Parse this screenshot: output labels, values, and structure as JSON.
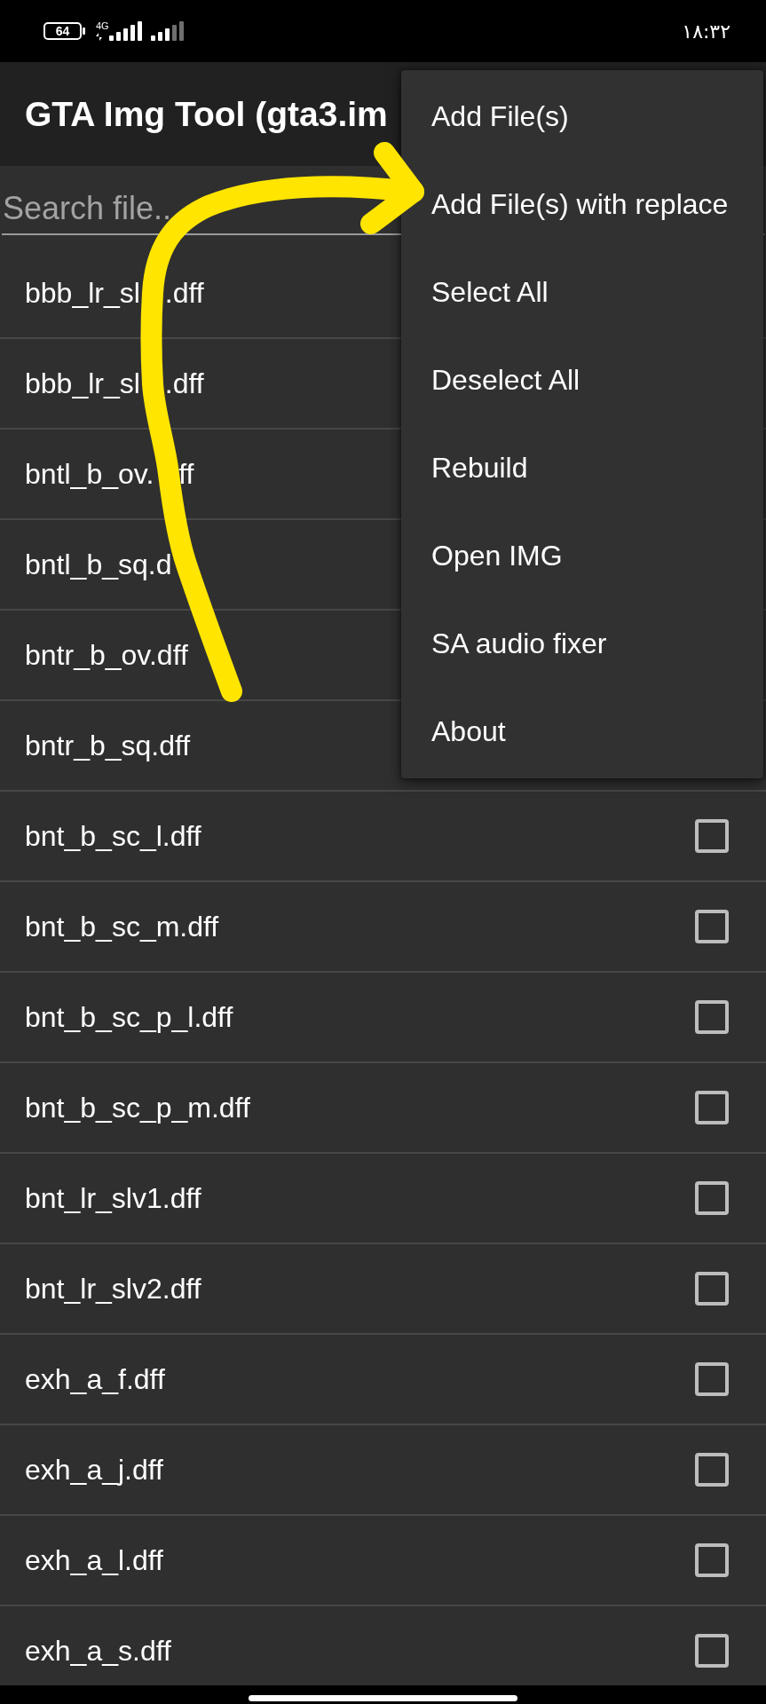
{
  "status_bar": {
    "battery": "64",
    "network_type": "4G",
    "time": "۱۸:۳۲"
  },
  "app_bar": {
    "title": "GTA Img Tool (gta3.im"
  },
  "search": {
    "placeholder": "Search file.."
  },
  "files": [
    {
      "name_fragments": [
        "bbb_lr_sl",
        ".dff"
      ]
    },
    {
      "name_fragments": [
        "bbb_lr_sl",
        ".dff"
      ]
    },
    {
      "name_fragments": [
        "bntl_b_ov.",
        "ff"
      ]
    },
    {
      "name_fragments": [
        "bntl_b_sq.d"
      ]
    },
    {
      "name": "bntr_b_ov.dff"
    },
    {
      "name": "bntr_b_sq.dff"
    },
    {
      "name": "bnt_b_sc_l.dff",
      "checked": false
    },
    {
      "name": "bnt_b_sc_m.dff",
      "checked": false
    },
    {
      "name": "bnt_b_sc_p_l.dff",
      "checked": false
    },
    {
      "name": "bnt_b_sc_p_m.dff",
      "checked": false
    },
    {
      "name": "bnt_lr_slv1.dff",
      "checked": false
    },
    {
      "name": "bnt_lr_slv2.dff",
      "checked": false
    },
    {
      "name": "exh_a_f.dff",
      "checked": false
    },
    {
      "name": "exh_a_j.dff",
      "checked": false
    },
    {
      "name": "exh_a_l.dff",
      "checked": false
    },
    {
      "name": "exh_a_s.dff",
      "checked": false
    }
  ],
  "menu": {
    "items": [
      "Add File(s)",
      "Add File(s) with replace",
      "Select All",
      "Deselect All",
      "Rebuild",
      "Open IMG",
      "SA audio fixer",
      "About"
    ]
  }
}
